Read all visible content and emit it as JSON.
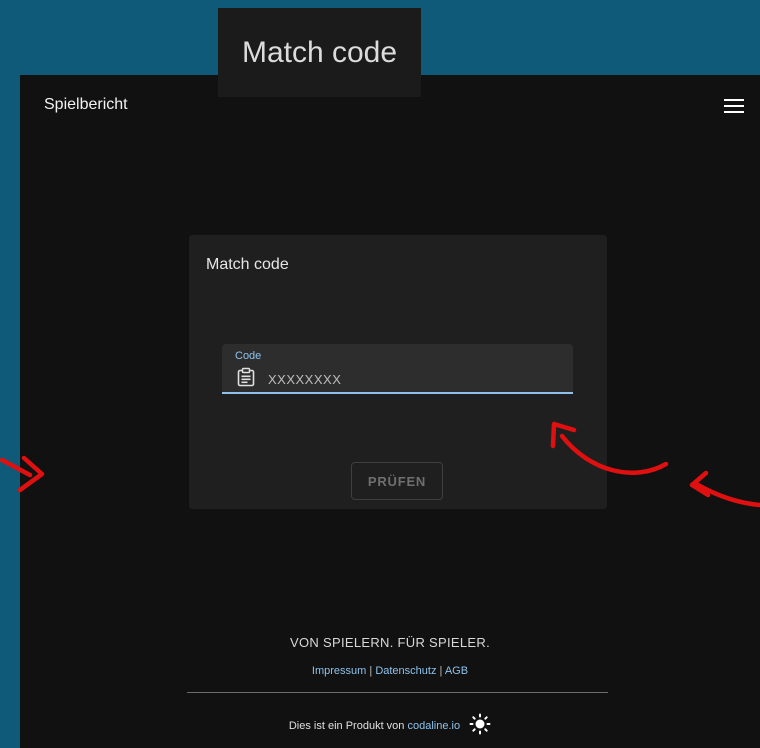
{
  "overlay": {
    "heading": "Match code"
  },
  "app": {
    "title": "Spielbericht",
    "menu_icon": "hamburger-menu-icon"
  },
  "card": {
    "title": "Match code",
    "code_field": {
      "label": "Code",
      "placeholder": "XXXXXXXX",
      "value": "",
      "icon": "clipboard-icon"
    },
    "check_button_label": "PRÜFEN"
  },
  "footer": {
    "slogan": "VON SPIELERN. FÜR SPIELER.",
    "links": [
      "Impressum",
      "Datenschutz",
      "AGB"
    ],
    "separator": "|",
    "credit_prefix": "Dies ist ein Produkt von",
    "credit_link": "codaline.io",
    "theme_icon": "sun-icon"
  },
  "colors": {
    "background": "#0e5a78",
    "frame": "#111111",
    "card": "#1f1f1f",
    "accent": "#8ec2ec",
    "annotation_red": "#e01010"
  }
}
